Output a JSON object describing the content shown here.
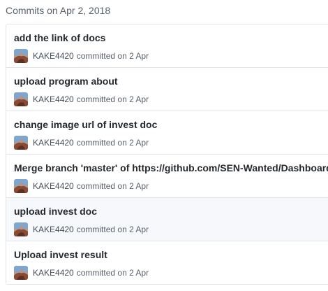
{
  "group_header": "Commits on Apr 2, 2018",
  "icons": {
    "avatar": "user-avatar-icon"
  },
  "colors": {
    "title_text": "#24292e",
    "meta_text": "#586069",
    "border": "#e1e4e8",
    "highlight_row": "#f6f8fc"
  },
  "commits": [
    {
      "title": "add the link of docs",
      "author": "KAKE4420",
      "committed_text": "committed on 2 Apr"
    },
    {
      "title": "upload program about",
      "author": "KAKE4420",
      "committed_text": "committed on 2 Apr"
    },
    {
      "title": "change image url of invest doc",
      "author": "KAKE4420",
      "committed_text": "committed on 2 Apr"
    },
    {
      "title": "Merge branch 'master' of https://github.com/SEN-Wanted/Dashboard",
      "author": "KAKE4420",
      "committed_text": "committed on 2 Apr"
    },
    {
      "title": "upload invest doc",
      "author": "KAKE4420",
      "committed_text": "committed on 2 Apr"
    },
    {
      "title": "Upload invest result",
      "author": "KAKE4420",
      "committed_text": "committed on 2 Apr"
    }
  ]
}
